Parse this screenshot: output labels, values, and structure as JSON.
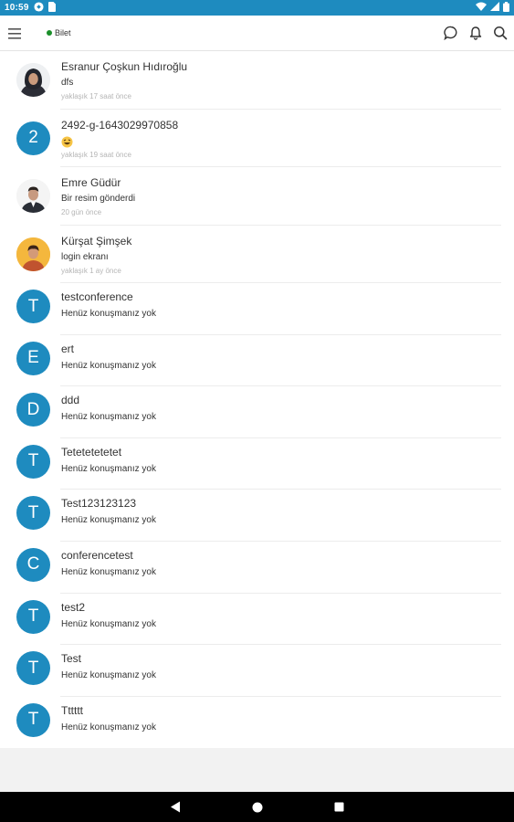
{
  "status_bar": {
    "time": "10:59"
  },
  "header": {
    "presence_label": "Bilet",
    "presence_color": "#1a8f2a"
  },
  "colors": {
    "accent": "#1e8bbf",
    "avatar_bg": "#1e8bbf"
  },
  "conversations": [
    {
      "name": "Esranur Çoşkun Hıdıroğlu",
      "last_message": "dfs",
      "time": "yaklaşık 17 saat önce",
      "avatar_type": "photo",
      "avatar_icon": "woman-hijab-photo"
    },
    {
      "name": "2492-g-1643029970858",
      "last_message": "😆",
      "time": "yaklaşık 19 saat önce",
      "avatar_type": "letter",
      "avatar_letter": "2"
    },
    {
      "name": "Emre Güdür",
      "last_message": "Bir resim gönderdi",
      "time": "20 gün önce",
      "avatar_type": "photo",
      "avatar_icon": "man-suit-photo"
    },
    {
      "name": "Kürşat Şimşek",
      "last_message": "login ekranı",
      "time": "yaklaşık 1 ay önce",
      "avatar_type": "photo",
      "avatar_icon": "man-yellow-bg-photo"
    }
  ],
  "empty_conversations": [
    {
      "name": "testconference",
      "message": "Henüz konuşmanız yok",
      "avatar_letter": "T"
    },
    {
      "name": "ert",
      "message": "Henüz konuşmanız yok",
      "avatar_letter": "E"
    },
    {
      "name": "ddd",
      "message": "Henüz konuşmanız yok",
      "avatar_letter": "D"
    },
    {
      "name": "Tetetetetetet",
      "message": "Henüz konuşmanız yok",
      "avatar_letter": "T"
    },
    {
      "name": "Test123123123",
      "message": "Henüz konuşmanız yok",
      "avatar_letter": "T"
    },
    {
      "name": "conferencetest",
      "message": "Henüz konuşmanız yok",
      "avatar_letter": "C"
    },
    {
      "name": "test2",
      "message": "Henüz konuşmanız yok",
      "avatar_letter": "T"
    },
    {
      "name": "Test",
      "message": "Henüz konuşmanız yok",
      "avatar_letter": "T"
    },
    {
      "name": "Tttttt",
      "message": "Henüz konuşmanız yok",
      "avatar_letter": "T"
    }
  ]
}
